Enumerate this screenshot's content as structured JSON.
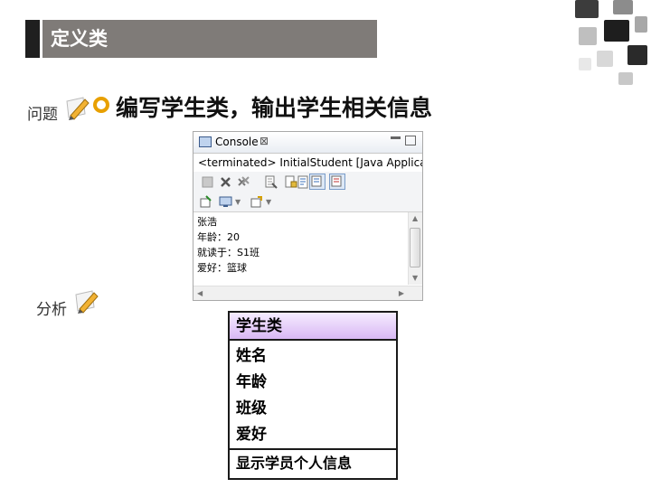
{
  "slide": {
    "title": "定义类",
    "heading": "编写学生类，输出学生相关信息",
    "labels": {
      "question": "问题",
      "analysis": "分析"
    },
    "colors": {
      "title_bar": "#7f7b78",
      "bullet": "#e8a000",
      "uml_header": "#d8b8f4"
    }
  },
  "console": {
    "tab_label": "Console",
    "close_glyph": "⊠",
    "status": "<terminated> InitialStudent [Java Application",
    "output": [
      "张浩",
      "年龄：20",
      "就读于：S1班",
      "爱好：篮球"
    ]
  },
  "uml": {
    "class_name": "学生类",
    "attributes": [
      "姓名",
      "年龄",
      "班级",
      "爱好"
    ],
    "methods": [
      "显示学员个人信息"
    ]
  }
}
